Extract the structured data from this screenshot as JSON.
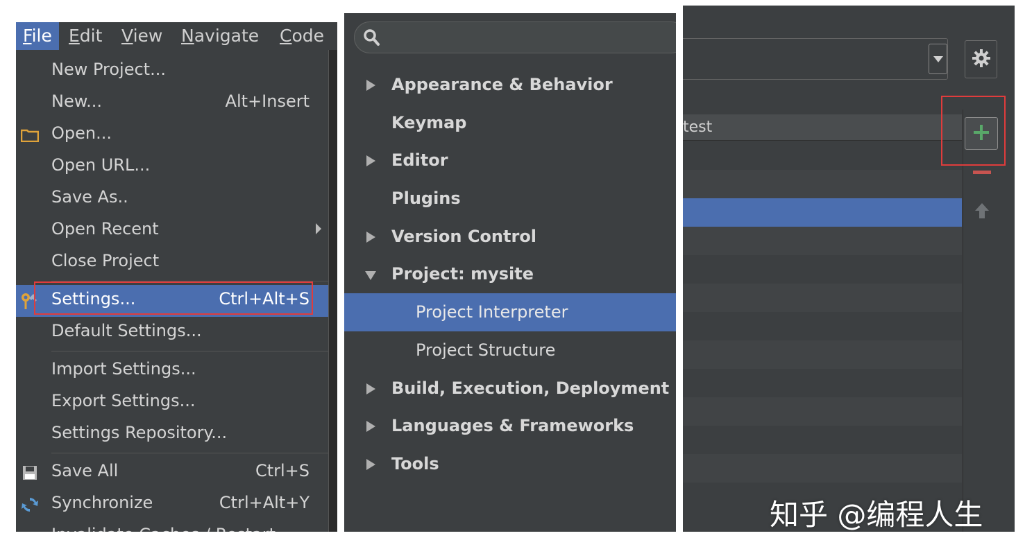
{
  "menubar": {
    "items": [
      {
        "label": "File",
        "mnemonic": "F",
        "rest": "ile"
      },
      {
        "label": "Edit",
        "mnemonic": "E",
        "rest": "dit"
      },
      {
        "label": "View",
        "mnemonic": "V",
        "rest": "iew"
      },
      {
        "label": "Navigate",
        "mnemonic": "N",
        "rest": "avigate"
      },
      {
        "label": "Code",
        "mnemonic": "C",
        "rest": "ode"
      }
    ]
  },
  "file_menu": {
    "items": [
      {
        "label": "New Project...",
        "shortcut": ""
      },
      {
        "label": "New...",
        "shortcut": "Alt+Insert"
      },
      {
        "label": "Open...",
        "shortcut": "",
        "icon": "folder-icon"
      },
      {
        "label": "Open URL...",
        "shortcut": ""
      },
      {
        "label": "Save As..",
        "shortcut": ""
      },
      {
        "label": "Open Recent",
        "shortcut": "",
        "submenu": true
      },
      {
        "label": "Close Project",
        "shortcut": ""
      },
      {
        "label": "Settings...",
        "shortcut": "Ctrl+Alt+S",
        "icon": "wrench-icon",
        "highlighted": true
      },
      {
        "label": "Default Settings...",
        "shortcut": ""
      },
      {
        "label": "Import Settings...",
        "shortcut": ""
      },
      {
        "label": "Export Settings...",
        "shortcut": ""
      },
      {
        "label": "Settings Repository...",
        "shortcut": ""
      },
      {
        "label": "Save All",
        "shortcut": "Ctrl+S",
        "icon": "floppy-disk-icon"
      },
      {
        "label": "Synchronize",
        "shortcut": "Ctrl+Alt+Y",
        "icon": "sync-icon"
      },
      {
        "label": "Invalidate Caches / Restart...",
        "shortcut": ""
      }
    ]
  },
  "settings_tree": {
    "search": {
      "value": "",
      "placeholder": ""
    },
    "items": [
      {
        "label": "Appearance & Behavior",
        "arrow": "right"
      },
      {
        "label": "Keymap",
        "arrow": "none"
      },
      {
        "label": "Editor",
        "arrow": "right"
      },
      {
        "label": "Plugins",
        "arrow": "none"
      },
      {
        "label": "Version Control",
        "arrow": "right"
      },
      {
        "label": "Project: mysite",
        "arrow": "down"
      },
      {
        "label": "Project Interpreter",
        "child": true,
        "selected": true
      },
      {
        "label": "Project Structure",
        "child": true
      },
      {
        "label": "Build, Execution, Deployment",
        "arrow": "right"
      },
      {
        "label": "Languages & Frameworks",
        "arrow": "right"
      },
      {
        "label": "Tools",
        "arrow": "right"
      }
    ]
  },
  "interpreter": {
    "table_header": "test"
  },
  "watermark": "知乎 @编程人生",
  "colors": {
    "panel_bg": "#3c3f41",
    "selection": "#4b6eaf",
    "highlight_box": "#e03c3c",
    "add_green": "#59a869",
    "remove_red": "#c75450"
  }
}
